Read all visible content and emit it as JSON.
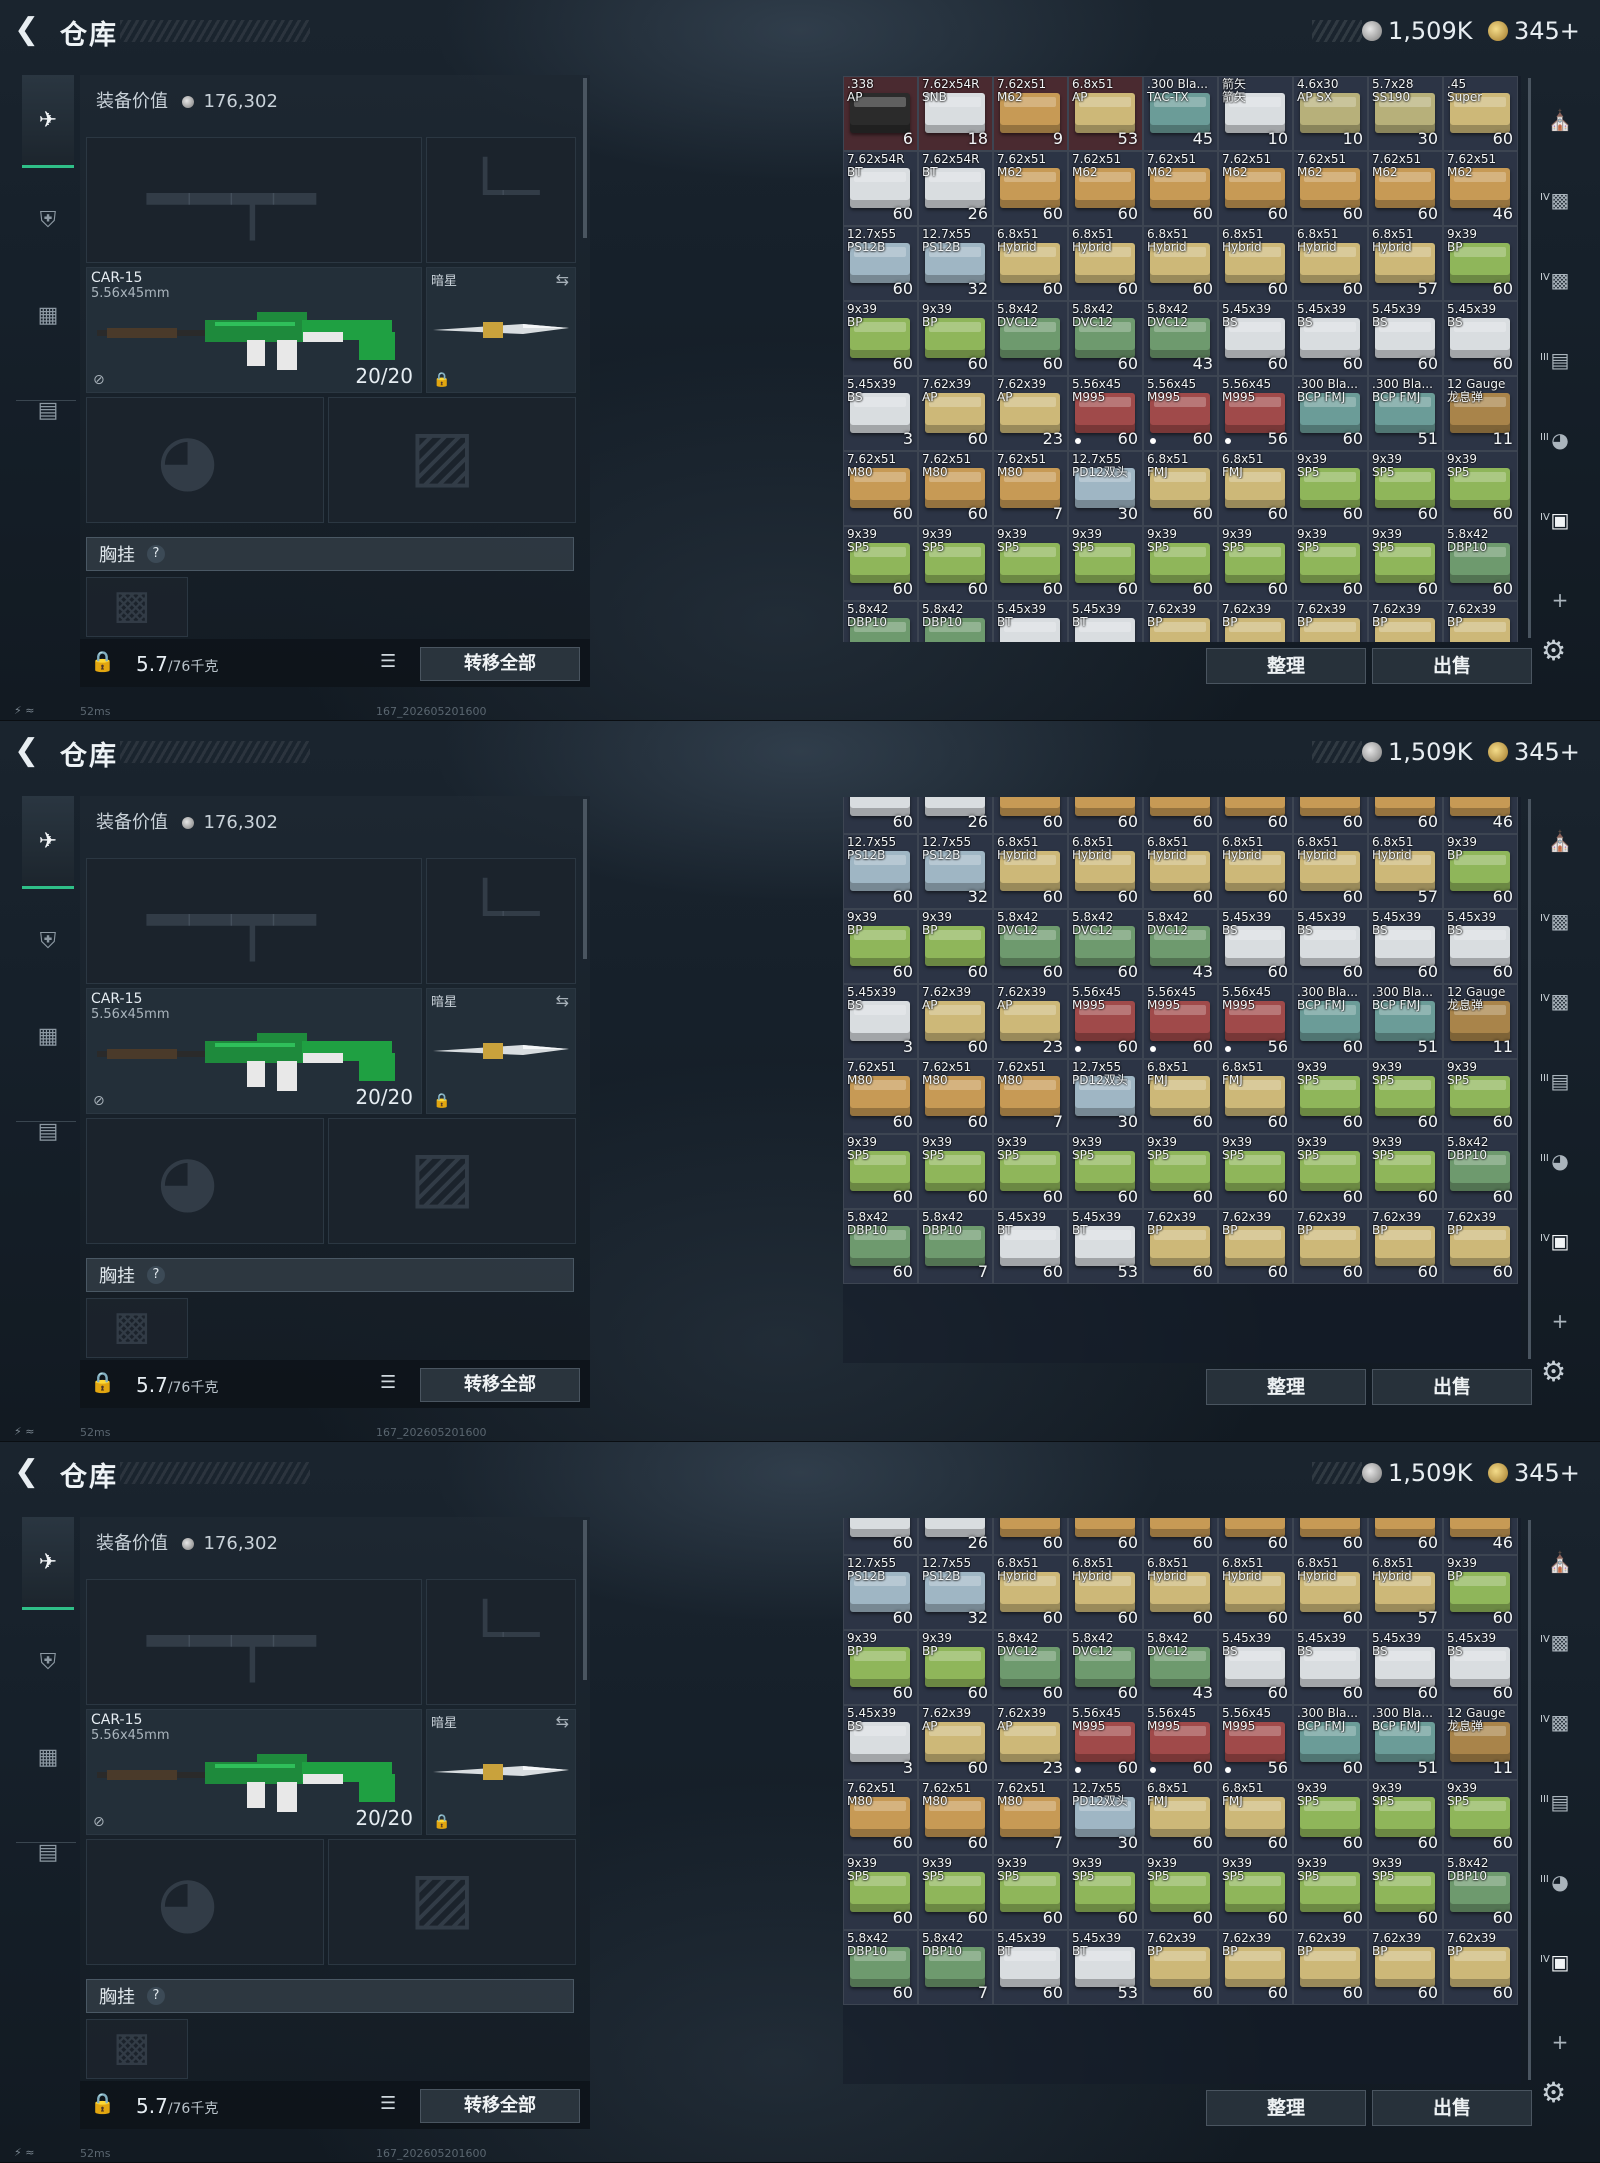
{
  "header": {
    "title": "仓库",
    "currency_silver": "1,509K",
    "currency_gold": "345+"
  },
  "loadout": {
    "equip_value_label": "装备价值",
    "equip_value": "176,302",
    "primary_weapon": {
      "name": "CAR-15",
      "caliber": "5.56x45mm",
      "ammo": "20/20"
    },
    "melee": {
      "name": "暗星"
    },
    "chest_rig_label": "胸挂",
    "chest_rig_help": "?",
    "weight": "5.7",
    "weight_unit": "/76千克",
    "transfer_all": "转移全部"
  },
  "stash": {
    "sort_label": "整理",
    "sell_label": "出售"
  },
  "status": {
    "ping": "52ms",
    "build": "167_202605201600"
  },
  "grid_rows": {
    "r0": [
      {
        "l": ".338\nAP",
        "c": "6",
        "col": "c-black",
        "t": "t-red"
      },
      {
        "l": "7.62x54R\nSNB",
        "c": "18",
        "col": "c-white",
        "t": "t-red"
      },
      {
        "l": "7.62x51\nM62",
        "c": "9",
        "col": "c-tan",
        "t": "t-red"
      },
      {
        "l": "6.8x51\nAP",
        "c": "53",
        "col": "c-yellow",
        "t": "t-red"
      },
      {
        "l": ".300 Bla...\nTAC-TX",
        "c": "45",
        "col": "c-teal",
        "t": ""
      },
      {
        "l": "箭矢\n箭矢",
        "c": "10",
        "col": "c-white",
        "t": ""
      },
      {
        "l": "4.6x30\nAP SX",
        "c": "10",
        "col": "c-olive",
        "t": ""
      },
      {
        "l": "5.7x28\nSS190",
        "c": "30",
        "col": "c-olive",
        "t": ""
      },
      {
        "l": ".45\nSuper",
        "c": "60",
        "col": "c-yellow",
        "t": ""
      }
    ],
    "r1": [
      {
        "l": "7.62x54R\nBT",
        "c": "60",
        "col": "c-white",
        "t": ""
      },
      {
        "l": "7.62x54R\nBT",
        "c": "26",
        "col": "c-white",
        "t": ""
      },
      {
        "l": "7.62x51\nM62",
        "c": "60",
        "col": "c-tan",
        "t": ""
      },
      {
        "l": "7.62x51\nM62",
        "c": "60",
        "col": "c-tan",
        "t": ""
      },
      {
        "l": "7.62x51\nM62",
        "c": "60",
        "col": "c-tan",
        "t": ""
      },
      {
        "l": "7.62x51\nM62",
        "c": "60",
        "col": "c-tan",
        "t": ""
      },
      {
        "l": "7.62x51\nM62",
        "c": "60",
        "col": "c-tan",
        "t": ""
      },
      {
        "l": "7.62x51\nM62",
        "c": "60",
        "col": "c-tan",
        "t": ""
      },
      {
        "l": "7.62x51\nM62",
        "c": "46",
        "col": "c-tan",
        "t": ""
      }
    ],
    "r2": [
      {
        "l": "12.7x55\nPS12B",
        "c": "60",
        "col": "c-blue",
        "t": ""
      },
      {
        "l": "12.7x55\nPS12B",
        "c": "32",
        "col": "c-blue",
        "t": ""
      },
      {
        "l": "6.8x51\nHybrid",
        "c": "60",
        "col": "c-yellow",
        "t": ""
      },
      {
        "l": "6.8x51\nHybrid",
        "c": "60",
        "col": "c-yellow",
        "t": ""
      },
      {
        "l": "6.8x51\nHybrid",
        "c": "60",
        "col": "c-yellow",
        "t": ""
      },
      {
        "l": "6.8x51\nHybrid",
        "c": "60",
        "col": "c-yellow",
        "t": ""
      },
      {
        "l": "6.8x51\nHybrid",
        "c": "60",
        "col": "c-yellow",
        "t": ""
      },
      {
        "l": "6.8x51\nHybrid",
        "c": "57",
        "col": "c-yellow",
        "t": ""
      },
      {
        "l": "9x39\nBP",
        "c": "60",
        "col": "c-lime",
        "t": ""
      }
    ],
    "r3": [
      {
        "l": "9x39\nBP",
        "c": "60",
        "col": "c-lime",
        "t": ""
      },
      {
        "l": "9x39\nBP",
        "c": "60",
        "col": "c-lime",
        "t": ""
      },
      {
        "l": "5.8x42\nDVC12",
        "c": "60",
        "col": "c-green",
        "t": ""
      },
      {
        "l": "5.8x42\nDVC12",
        "c": "60",
        "col": "c-green",
        "t": ""
      },
      {
        "l": "5.8x42\nDVC12",
        "c": "43",
        "col": "c-green",
        "t": ""
      },
      {
        "l": "5.45x39\nBS",
        "c": "60",
        "col": "c-white",
        "t": ""
      },
      {
        "l": "5.45x39\nBS",
        "c": "60",
        "col": "c-white",
        "t": ""
      },
      {
        "l": "5.45x39\nBS",
        "c": "60",
        "col": "c-white",
        "t": ""
      },
      {
        "l": "5.45x39\nBS",
        "c": "60",
        "col": "c-white",
        "t": ""
      }
    ],
    "r4": [
      {
        "l": "5.45x39\nBS",
        "c": "3",
        "col": "c-white",
        "t": ""
      },
      {
        "l": "7.62x39\nAP",
        "c": "60",
        "col": "c-yellow",
        "t": ""
      },
      {
        "l": "7.62x39\nAP",
        "c": "23",
        "col": "c-yellow",
        "t": ""
      },
      {
        "l": "5.56x45\nM995",
        "c": "60",
        "col": "c-red",
        "t": "",
        "d": true
      },
      {
        "l": "5.56x45\nM995",
        "c": "60",
        "col": "c-red",
        "t": "",
        "d": true
      },
      {
        "l": "5.56x45\nM995",
        "c": "56",
        "col": "c-red",
        "t": "",
        "d": true
      },
      {
        "l": ".300 Bla...\nBCP FMJ",
        "c": "60",
        "col": "c-teal",
        "t": ""
      },
      {
        "l": ".300 Bla...\nBCP FMJ",
        "c": "51",
        "col": "c-teal",
        "t": ""
      },
      {
        "l": "12 Gauge\n龙息弹",
        "c": "11",
        "col": "c-brown",
        "t": ""
      }
    ],
    "r5": [
      {
        "l": "7.62x51\nM80",
        "c": "60",
        "col": "c-tan",
        "t": ""
      },
      {
        "l": "7.62x51\nM80",
        "c": "60",
        "col": "c-tan",
        "t": ""
      },
      {
        "l": "7.62x51\nM80",
        "c": "7",
        "col": "c-tan",
        "t": ""
      },
      {
        "l": "12.7x55\nPD12双头",
        "c": "30",
        "col": "c-blue",
        "t": ""
      },
      {
        "l": "6.8x51\nFMJ",
        "c": "60",
        "col": "c-yellow",
        "t": ""
      },
      {
        "l": "6.8x51\nFMJ",
        "c": "60",
        "col": "c-yellow",
        "t": ""
      },
      {
        "l": "9x39\nSP5",
        "c": "60",
        "col": "c-lime",
        "t": ""
      },
      {
        "l": "9x39\nSP5",
        "c": "60",
        "col": "c-lime",
        "t": ""
      },
      {
        "l": "9x39\nSP5",
        "c": "60",
        "col": "c-lime",
        "t": ""
      }
    ],
    "r6": [
      {
        "l": "9x39\nSP5",
        "c": "60",
        "col": "c-lime",
        "t": ""
      },
      {
        "l": "9x39\nSP5",
        "c": "60",
        "col": "c-lime",
        "t": ""
      },
      {
        "l": "9x39\nSP5",
        "c": "60",
        "col": "c-lime",
        "t": ""
      },
      {
        "l": "9x39\nSP5",
        "c": "60",
        "col": "c-lime",
        "t": ""
      },
      {
        "l": "9x39\nSP5",
        "c": "60",
        "col": "c-lime",
        "t": ""
      },
      {
        "l": "9x39\nSP5",
        "c": "60",
        "col": "c-lime",
        "t": ""
      },
      {
        "l": "9x39\nSP5",
        "c": "60",
        "col": "c-lime",
        "t": ""
      },
      {
        "l": "9x39\nSP5",
        "c": "60",
        "col": "c-lime",
        "t": ""
      },
      {
        "l": "5.8x42\nDBP10",
        "c": "60",
        "col": "c-green",
        "t": ""
      }
    ],
    "r7": [
      {
        "l": "5.8x42\nDBP10",
        "c": "60",
        "col": "c-green",
        "t": ""
      },
      {
        "l": "5.8x42\nDBP10",
        "c": "7",
        "col": "c-green",
        "t": ""
      },
      {
        "l": "5.45x39\nBT",
        "c": "60",
        "col": "c-white",
        "t": ""
      },
      {
        "l": "5.45x39\nBT",
        "c": "53",
        "col": "c-white",
        "t": ""
      },
      {
        "l": "7.62x39\nBP",
        "c": "60",
        "col": "c-yellow",
        "t": ""
      },
      {
        "l": "7.62x39\nBP",
        "c": "60",
        "col": "c-yellow",
        "t": ""
      },
      {
        "l": "7.62x39\nBP",
        "c": "60",
        "col": "c-yellow",
        "t": ""
      },
      {
        "l": "7.62x39\nBP",
        "c": "60",
        "col": "c-yellow",
        "t": ""
      },
      {
        "l": "7.62x39\nBP",
        "c": "60",
        "col": "c-yellow",
        "t": ""
      }
    ]
  },
  "frames": [
    {
      "rows": [
        "r0",
        "r1",
        "r2",
        "r3",
        "r4",
        "r5",
        "r6",
        "r7"
      ],
      "trim_top": false
    },
    {
      "rows": [
        "r1",
        "r2",
        "r3",
        "r4",
        "r5",
        "r6",
        "r7"
      ],
      "trim_top": true
    },
    {
      "rows": [
        "r1",
        "r2",
        "r3",
        "r4",
        "r5",
        "r6",
        "r7"
      ],
      "trim_top": true
    }
  ]
}
